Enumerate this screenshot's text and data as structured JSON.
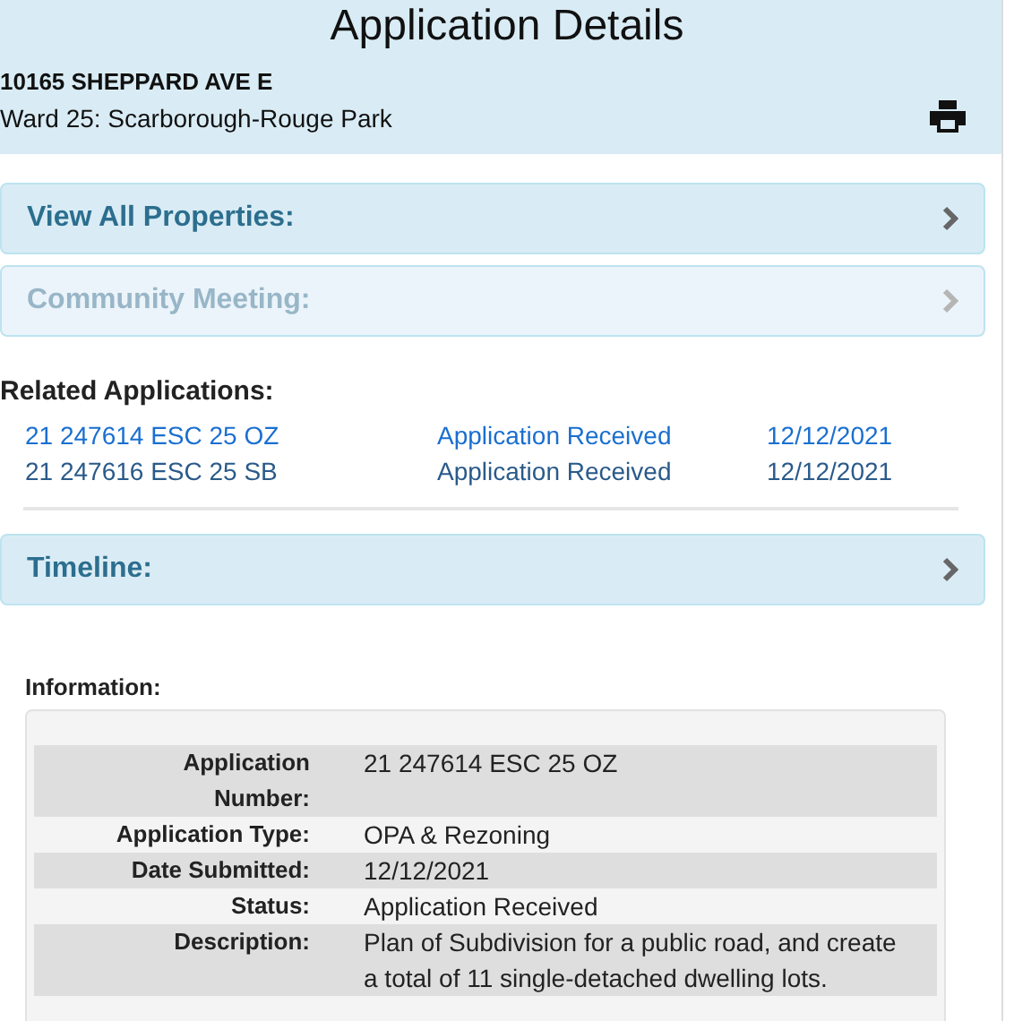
{
  "header": {
    "title": "Application Details",
    "address": "10165 SHEPPARD AVE E",
    "ward": "Ward 25: Scarborough-Rouge Park"
  },
  "panels": [
    {
      "label": "View All Properties:",
      "disabled": false
    },
    {
      "label": "Community Meeting:",
      "disabled": true
    }
  ],
  "related": {
    "title": "Related Applications:",
    "rows": [
      {
        "number": "21 247614 ESC 25 OZ",
        "status": "Application Received",
        "date": "12/12/2021",
        "selected": true
      },
      {
        "number": "21 247616 ESC 25 SB",
        "status": "Application Received",
        "date": "12/12/2021",
        "selected": false
      }
    ]
  },
  "timeline": {
    "label": "Timeline:",
    "disabled": false
  },
  "information": {
    "title": "Information:",
    "rows": [
      {
        "label": "Application Number:",
        "value": "21 247614 ESC 25 OZ"
      },
      {
        "label": "Application Type:",
        "value": "OPA & Rezoning"
      },
      {
        "label": "Date Submitted:",
        "value": "12/12/2021"
      },
      {
        "label": "Status:",
        "value": "Application Received"
      },
      {
        "label": "Description:",
        "value": "Plan of Subdivision for a public road, and create a total of 11 single-detached dwelling lots."
      }
    ]
  }
}
